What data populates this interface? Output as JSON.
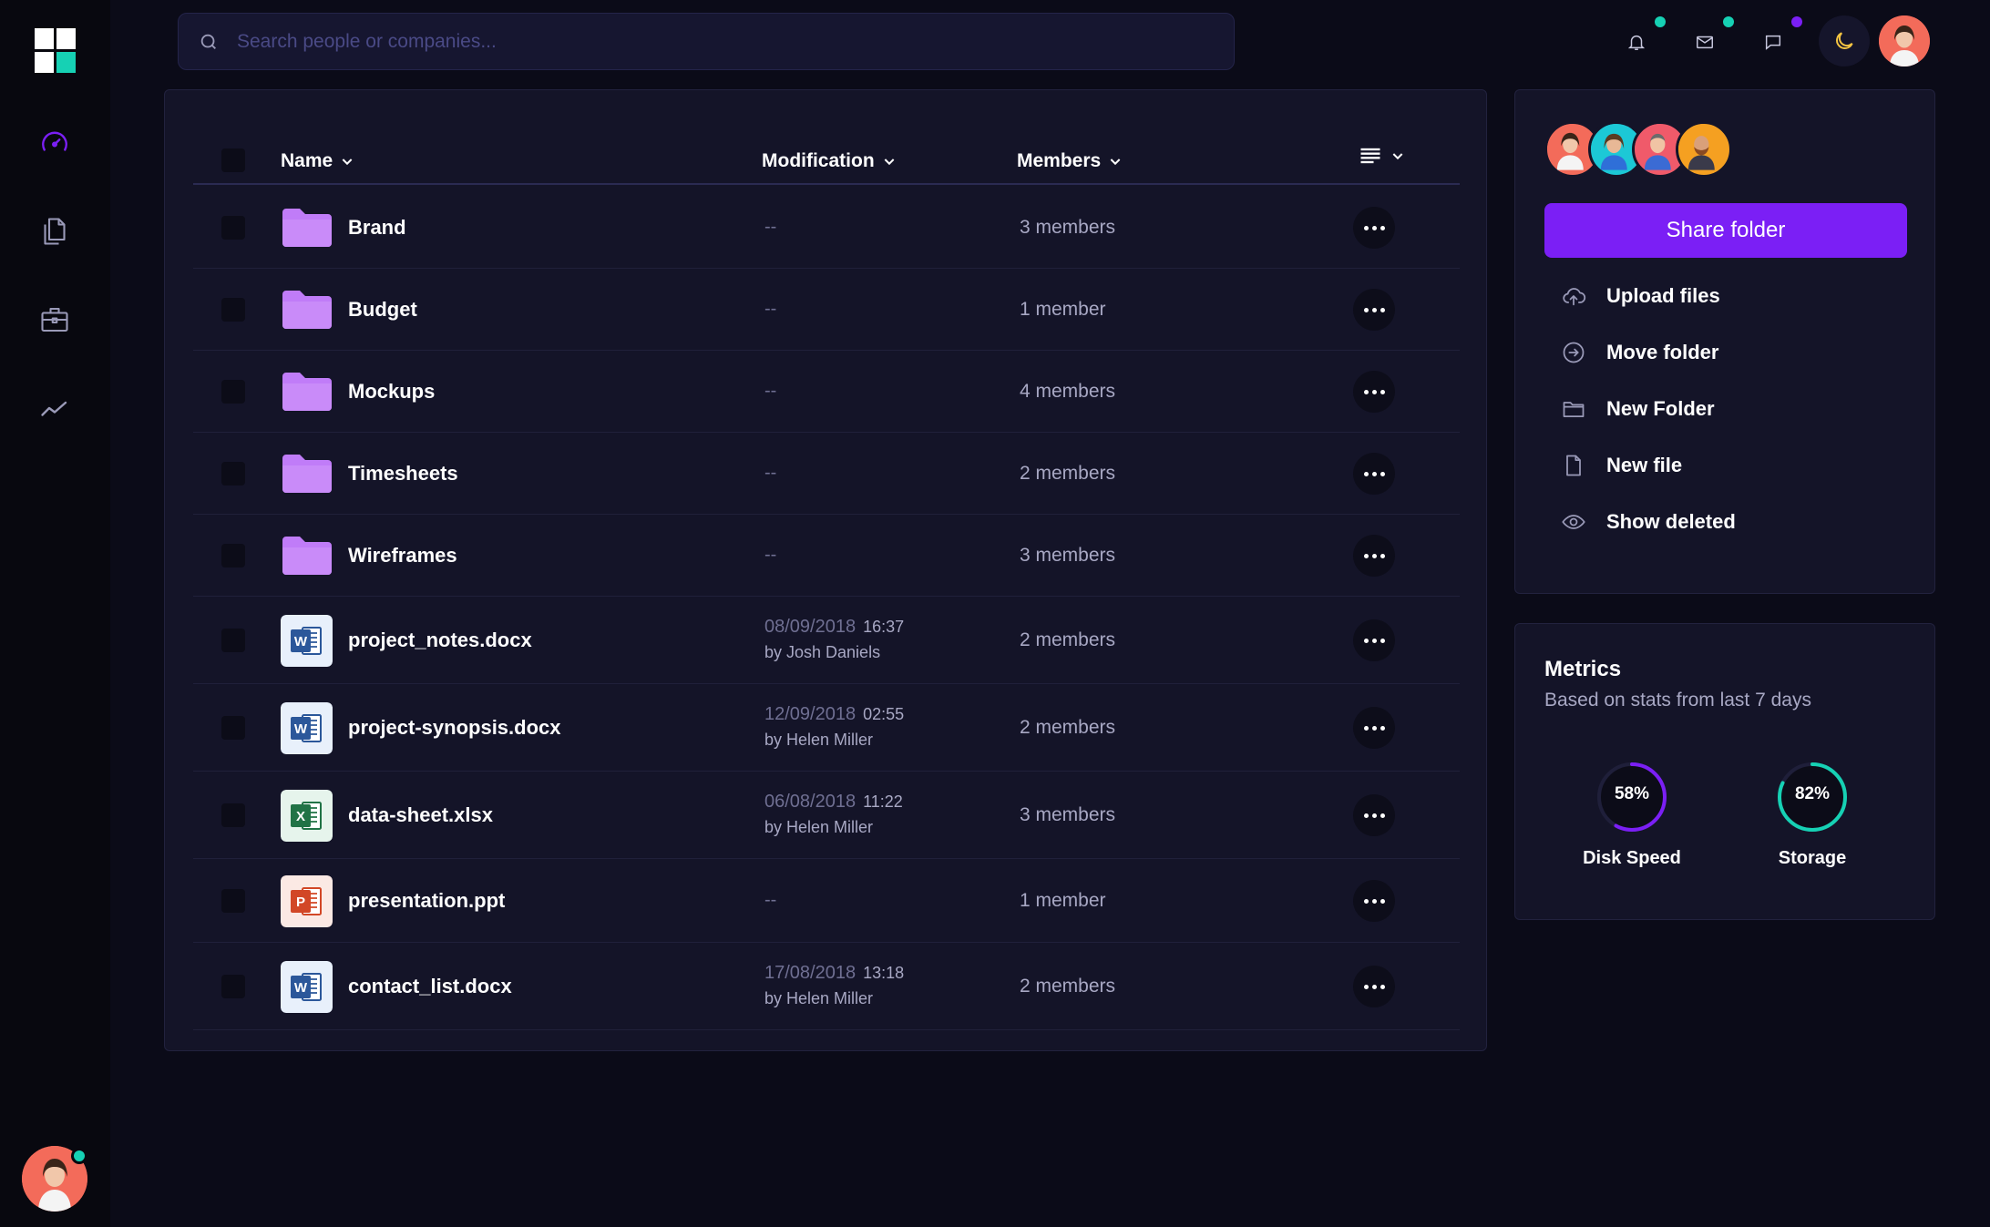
{
  "header": {
    "search_placeholder": "Search people or companies...",
    "notification_dot_color": "#16d1b4",
    "mail_dot_color": "#16d1b4",
    "chat_dot_color": "#7b1ff5"
  },
  "table": {
    "columns": {
      "name": "Name",
      "modification": "Modification",
      "members": "Members"
    },
    "rows": [
      {
        "name": "Brand",
        "type": "folder",
        "modification": "--",
        "members": "3 members"
      },
      {
        "name": "Budget",
        "type": "folder",
        "modification": "--",
        "members": "1 member"
      },
      {
        "name": "Mockups",
        "type": "folder",
        "modification": "--",
        "members": "4 members"
      },
      {
        "name": "Timesheets",
        "type": "folder",
        "modification": "--",
        "members": "2 members"
      },
      {
        "name": "Wireframes",
        "type": "folder",
        "modification": "--",
        "members": "3 members"
      },
      {
        "name": "project_notes.docx",
        "type": "word",
        "mod_date": "08/09/2018",
        "mod_time": "16:37",
        "mod_by": "by Josh Daniels",
        "members": "2 members"
      },
      {
        "name": "project-synopsis.docx",
        "type": "word",
        "mod_date": "12/09/2018",
        "mod_time": "02:55",
        "mod_by": "by Helen Miller",
        "members": "2 members"
      },
      {
        "name": "data-sheet.xlsx",
        "type": "excel",
        "mod_date": "06/08/2018",
        "mod_time": "11:22",
        "mod_by": "by Helen Miller",
        "members": "3 members"
      },
      {
        "name": "presentation.ppt",
        "type": "powerpoint",
        "modification": "--",
        "members": "1 member"
      },
      {
        "name": "contact_list.docx",
        "type": "word",
        "mod_date": "17/08/2018",
        "mod_time": "13:18",
        "mod_by": "by Helen Miller",
        "members": "2 members"
      }
    ]
  },
  "actions": {
    "share_label": "Share folder",
    "items": [
      {
        "label": "Upload files",
        "icon": "cloud-upload-icon"
      },
      {
        "label": "Move folder",
        "icon": "arrow-circle-right-icon"
      },
      {
        "label": "New Folder",
        "icon": "folder-icon"
      },
      {
        "label": "New file",
        "icon": "file-icon"
      },
      {
        "label": "Show deleted",
        "icon": "eye-icon"
      }
    ]
  },
  "metrics": {
    "title": "Metrics",
    "subtitle": "Based on stats from last 7 days",
    "gauges": [
      {
        "label": "Disk Speed",
        "value": "58%",
        "fraction": 0.58,
        "color": "#7b1ff5"
      },
      {
        "label": "Storage",
        "value": "82%",
        "fraction": 0.82,
        "color": "#16d1b4"
      }
    ]
  },
  "colors": {
    "accent": "#7b1ff5",
    "teal": "#16d1b4",
    "folder": "#c07cf8"
  }
}
